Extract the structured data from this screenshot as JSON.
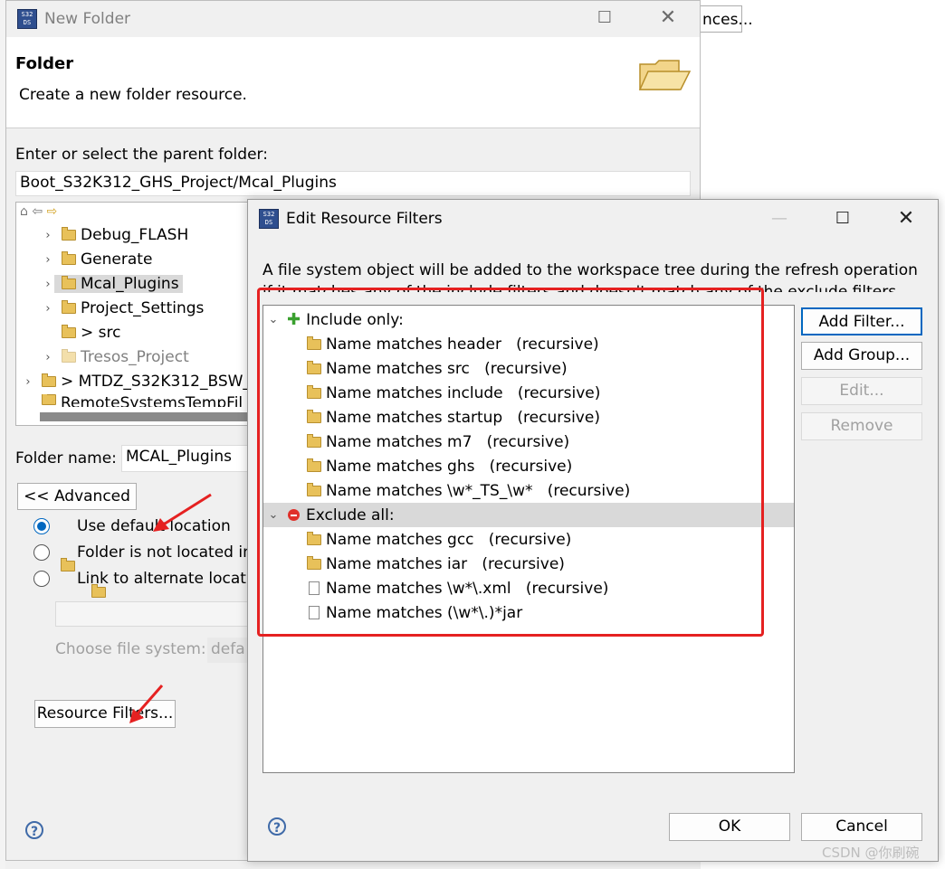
{
  "background": {
    "button_fragment": "nces..."
  },
  "new_folder": {
    "title": "New Folder",
    "header_title": "Folder",
    "header_desc": "Create a new folder resource.",
    "parent_label": "Enter or select the parent folder:",
    "parent_value": "Boot_S32K312_GHS_Project/Mcal_Plugins",
    "tree": [
      {
        "label": "Debug_FLASH",
        "expandable": true
      },
      {
        "label": "Generate",
        "expandable": true
      },
      {
        "label": "Mcal_Plugins",
        "expandable": true,
        "selected": true
      },
      {
        "label": "Project_Settings",
        "expandable": true
      },
      {
        "label": "> src",
        "expandable": false
      },
      {
        "label": "Tresos_Project",
        "expandable": true,
        "dimmed": true
      },
      {
        "label": "> MTDZ_S32K312_BSW_",
        "expandable": true,
        "project": true
      },
      {
        "label": "RemoteSystemsTempFil",
        "expandable": false
      }
    ],
    "folder_name_label": "Folder name:",
    "folder_name_value": "MCAL_Plugins",
    "advanced_button": "<< Advanced",
    "radio_options": [
      {
        "label": "Use default location",
        "selected": true
      },
      {
        "label": "Folder is not located in",
        "selected": false
      },
      {
        "label": "Link to alternate locat",
        "selected": false
      }
    ],
    "choose_fs_label": "Choose file system:",
    "choose_fs_value": "defa",
    "resource_filters_button": "Resource Filters..."
  },
  "edit_filters": {
    "title": "Edit Resource Filters",
    "description_line1": "A file system object will be added to the workspace tree during the refresh operation",
    "description_line2": "if it matches any of the include filters and doesn't match any of the exclude filters.",
    "groups": [
      {
        "label": "Include only:",
        "kind": "include",
        "items": [
          {
            "text": "Name matches header   (recursive)",
            "icon": "folder-icon"
          },
          {
            "text": "Name matches src   (recursive)",
            "icon": "folder-icon"
          },
          {
            "text": "Name matches include   (recursive)",
            "icon": "folder-icon"
          },
          {
            "text": "Name matches startup   (recursive)",
            "icon": "folder-icon"
          },
          {
            "text": "Name matches m7   (recursive)",
            "icon": "folder-icon"
          },
          {
            "text": "Name matches ghs   (recursive)",
            "icon": "folder-icon"
          },
          {
            "text": "Name matches \\w*_TS_\\w*   (recursive)",
            "icon": "folder-icon"
          }
        ]
      },
      {
        "label": "Exclude all:",
        "kind": "exclude",
        "items": [
          {
            "text": "Name matches gcc   (recursive)",
            "icon": "folder-icon"
          },
          {
            "text": "Name matches iar   (recursive)",
            "icon": "folder-icon"
          },
          {
            "text": "Name matches \\w*\\.xml   (recursive)",
            "icon": "file-icon"
          },
          {
            "text": "Name matches (\\w*\\.)*jar",
            "icon": "file-icon"
          }
        ]
      }
    ],
    "buttons": {
      "add_filter": "Add Filter...",
      "add_group": "Add Group...",
      "edit": "Edit...",
      "remove": "Remove",
      "ok": "OK",
      "cancel": "Cancel"
    }
  },
  "watermark": "CSDN @你刷碗",
  "colors": {
    "highlight": "#e52121",
    "accent": "#0067c0"
  }
}
